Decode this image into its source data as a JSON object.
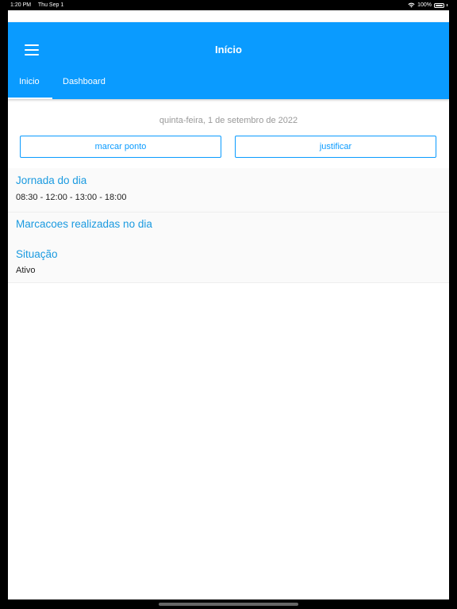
{
  "status_bar": {
    "time": "1:20 PM",
    "date": "Thu Sep 1",
    "wifi_icon": "wifi-icon",
    "battery": "100%"
  },
  "header": {
    "title": "Início",
    "menu_icon": "hamburger-menu-icon",
    "color": "#0a9bff",
    "tabs": [
      {
        "label": "Inicio",
        "active": true
      },
      {
        "label": "Dashboard",
        "active": false
      }
    ]
  },
  "main": {
    "date": "quinta-feira, 1 de setembro de 2022",
    "buttons": {
      "marcar": "marcar ponto",
      "justificar": "justificar"
    },
    "jornada": {
      "title": "Jornada do dia",
      "value": "08:30 - 12:00 - 13:00 - 18:00"
    },
    "marcacoes": {
      "title": "Marcacoes realizadas no dia"
    },
    "situacao": {
      "title": "Situação",
      "value": "Ativo"
    }
  }
}
